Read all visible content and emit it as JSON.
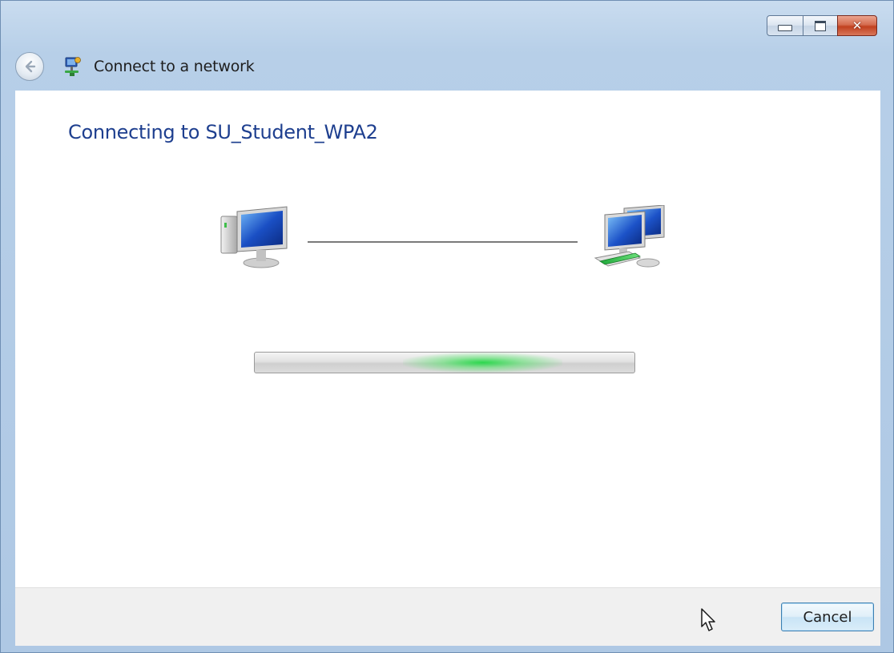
{
  "window": {
    "title": "Connect to a network",
    "icons": {
      "back": "back-arrow-icon",
      "dialog": "network-connect-icon",
      "minimize": "minimize-icon",
      "maximize": "maximize-icon",
      "close": "close-icon"
    }
  },
  "main": {
    "heading": "Connecting to SU_Student_WPA2",
    "source_icon": "computer-icon",
    "target_icon": "network-icon",
    "progress": {
      "mode": "indeterminate",
      "glow_position": 0.6
    }
  },
  "footer": {
    "cancel_label": "Cancel"
  },
  "colors": {
    "heading": "#1e3f8f",
    "frame": "#b7cfe8",
    "progress_glow": "#23d746"
  }
}
